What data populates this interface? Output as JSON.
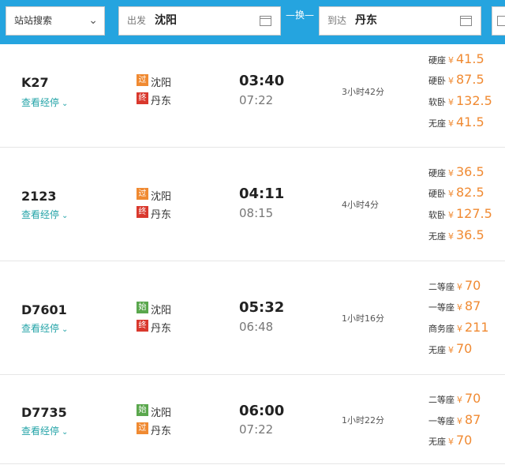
{
  "search": {
    "mode": "站站搜索",
    "from_label": "出发",
    "from_value": "沈阳",
    "swap_label": "换",
    "to_label": "到达",
    "to_value": "丹东"
  },
  "trains": [
    {
      "number": "K27",
      "stops_link": "查看经停",
      "from_badge": "过",
      "from_badge_type": "pass",
      "from_station": "沈阳",
      "to_badge": "终",
      "to_badge_type": "end",
      "to_station": "丹东",
      "depart": "03:40",
      "arrive": "07:22",
      "duration": "3小时42分",
      "prices": [
        {
          "seat": "硬座",
          "currency": "¥",
          "amount": "41.5"
        },
        {
          "seat": "硬卧",
          "currency": "¥",
          "amount": "87.5"
        },
        {
          "seat": "软卧",
          "currency": "¥",
          "amount": "132.5"
        },
        {
          "seat": "无座",
          "currency": "¥",
          "amount": "41.5"
        }
      ]
    },
    {
      "number": "2123",
      "stops_link": "查看经停",
      "from_badge": "过",
      "from_badge_type": "pass",
      "from_station": "沈阳",
      "to_badge": "终",
      "to_badge_type": "end",
      "to_station": "丹东",
      "depart": "04:11",
      "arrive": "08:15",
      "duration": "4小时4分",
      "prices": [
        {
          "seat": "硬座",
          "currency": "¥",
          "amount": "36.5"
        },
        {
          "seat": "硬卧",
          "currency": "¥",
          "amount": "82.5"
        },
        {
          "seat": "软卧",
          "currency": "¥",
          "amount": "127.5"
        },
        {
          "seat": "无座",
          "currency": "¥",
          "amount": "36.5"
        }
      ]
    },
    {
      "number": "D7601",
      "stops_link": "查看经停",
      "from_badge": "始",
      "from_badge_type": "start",
      "from_station": "沈阳",
      "to_badge": "终",
      "to_badge_type": "end",
      "to_station": "丹东",
      "depart": "05:32",
      "arrive": "06:48",
      "duration": "1小时16分",
      "prices": [
        {
          "seat": "二等座",
          "currency": "¥",
          "amount": "70"
        },
        {
          "seat": "一等座",
          "currency": "¥",
          "amount": "87"
        },
        {
          "seat": "商务座",
          "currency": "¥",
          "amount": "211"
        },
        {
          "seat": "无座",
          "currency": "¥",
          "amount": "70"
        }
      ]
    },
    {
      "number": "D7735",
      "stops_link": "查看经停",
      "from_badge": "始",
      "from_badge_type": "start",
      "from_station": "沈阳",
      "to_badge": "过",
      "to_badge_type": "pass",
      "to_station": "丹东",
      "depart": "06:00",
      "arrive": "07:22",
      "duration": "1小时22分",
      "prices": [
        {
          "seat": "二等座",
          "currency": "¥",
          "amount": "70"
        },
        {
          "seat": "一等座",
          "currency": "¥",
          "amount": "87"
        },
        {
          "seat": "无座",
          "currency": "¥",
          "amount": "70"
        }
      ]
    }
  ]
}
